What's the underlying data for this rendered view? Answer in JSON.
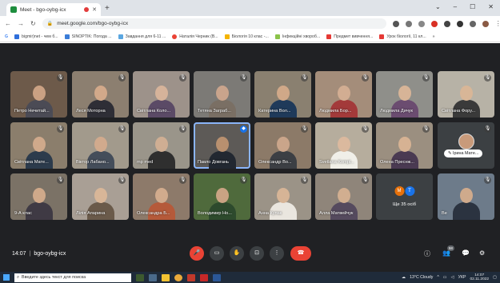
{
  "browser": {
    "tab_title": "Meet - bgo-oybg-icx",
    "new_tab": "+",
    "window_controls": [
      "⌄",
      "–",
      "☐",
      "✕"
    ],
    "url": "meet.google.com/bgo-oybg-icx"
  },
  "bookmarks": [
    {
      "label": "bigmir)net - чем б...",
      "color": "#2f6fdb"
    },
    {
      "label": "SINOPTIK: Погода ...",
      "color": "#3b7dd8"
    },
    {
      "label": "Завдання для 6-11 ...",
      "color": "#5aa6e0"
    },
    {
      "label": "Наталія Черник (В...",
      "color": "#ea4335"
    },
    {
      "label": "Біологія 10 клас -...",
      "color": "#f4b400"
    },
    {
      "label": "Інфекційні хвороб...",
      "color": "#8bc34a"
    },
    {
      "label": "Предмет вивчення...",
      "color": "#e53935"
    },
    {
      "label": "Урок біології, 11 кл...",
      "color": "#e53935"
    }
  ],
  "tiles": [
    {
      "name": "Петро Нечитай...",
      "bg": "#6d5a4a",
      "skin": "#caa183",
      "shirt": "#4b4b55",
      "mic": true
    },
    {
      "name": "Леся Моторна",
      "bg": "#8c7f70",
      "skin": "#d2a98a",
      "shirt": "#2e2e36",
      "mic": true
    },
    {
      "name": "Світлана Коло...",
      "bg": "#9d928a",
      "skin": "#d6b39a",
      "shirt": "#5b4a66",
      "mic": true
    },
    {
      "name": "Тетяна Заграб...",
      "bg": "#7c7a76",
      "skin": "#c9a48c",
      "shirt": "#7a6f64",
      "mic": true
    },
    {
      "name": "Катерина Вол...",
      "bg": "#8a8070",
      "skin": "#d0a888",
      "shirt": "#1f3a5a",
      "mic": true
    },
    {
      "name": "Людмила Бор...",
      "bg": "#a48d7a",
      "skin": "#d2ad92",
      "shirt": "#a33a3a",
      "mic": true
    },
    {
      "name": "Людмила Дичук",
      "bg": "#8f8f8a",
      "skin": "#d7b497",
      "shirt": "#6b4c70",
      "mic": true
    },
    {
      "name": "Світлана Фору...",
      "bg": "#b7b2a6",
      "skin": "#d8b697",
      "shirt": "#3a3a3a",
      "mic": true
    },
    {
      "name": "Світлана Мате...",
      "bg": "#8b7e6c",
      "skin": "#cfa98b",
      "shirt": "#2c3b4c",
      "mic": true
    },
    {
      "name": "Віктор Лабано...",
      "bg": "#a29a8c",
      "skin": "#d1aa8d",
      "shirt": "#444d5a",
      "mic": true
    },
    {
      "name": "mp med",
      "bg": "#9a958a",
      "skin": "#cfae93",
      "shirt": "#2f2f2f",
      "mic": true
    },
    {
      "name": "Павло Довгань",
      "bg": "#5d5a57",
      "skin": "#b8906f",
      "shirt": "#222831",
      "mic": false,
      "highlight": true
    },
    {
      "name": "Олександр Во...",
      "bg": "#8c7a68",
      "skin": "#caa58a",
      "shirt": "#3c3f44",
      "mic": true
    },
    {
      "name": "Svetlana Kompl...",
      "bg": "#b6ad9d",
      "skin": "#dbb99e",
      "shirt": "#f0efe8",
      "mic": true
    },
    {
      "name": "Олена Преснж...",
      "bg": "#9b8f80",
      "skin": "#d6b293",
      "shirt": "#4a3a52",
      "mic": true
    },
    {
      "name": "9-А клас",
      "bg": "#7b7266",
      "skin": "#cfa98a",
      "shirt": "#3f3a44",
      "mic": true
    },
    {
      "name": "Лілія Апарина",
      "bg": "#a99f95",
      "skin": "#d8b698",
      "shirt": "#6a5a4a",
      "mic": true
    },
    {
      "name": "Олександра Б...",
      "bg": "#8d7a6a",
      "skin": "#d1ab8d",
      "shirt": "#b55a3a",
      "mic": true
    },
    {
      "name": "Володимир Но...",
      "bg": "#4f6a3c",
      "skin": "#c9a383",
      "shirt": "#2d4a2d",
      "mic": true
    },
    {
      "name": "Анна Купак",
      "bg": "#9b9387",
      "skin": "#d6b496",
      "shirt": "#eae6df",
      "mic": true
    },
    {
      "name": "Алла Матвейчук",
      "bg": "#8f857a",
      "skin": "#d1ae90",
      "shirt": "#554a5e",
      "mic": true
    },
    {
      "name": "Ве",
      "bg": "#6d7b8a",
      "skin": "#cfaa8c",
      "shirt": "#2b3340",
      "mic": true
    }
  ],
  "avatar_tile": {
    "name": "Ірина Мате..."
  },
  "more_tile": {
    "initials": [
      "М",
      "Т"
    ],
    "label": "Ще 35 осіб"
  },
  "meeting": {
    "time": "14:07",
    "separator": "|",
    "code": "bgo-oybg-icx"
  },
  "controls": {
    "mic": "🎤",
    "camera": "▭",
    "hand": "✋",
    "present": "⊡",
    "more": "⋮",
    "end": "☎"
  },
  "right_controls": {
    "info": "ⓘ",
    "people": "👥",
    "people_count": "58",
    "chat": "💬",
    "activities": "⚙"
  },
  "taskbar": {
    "search_placeholder": "Введите здесь текст для поиска",
    "weather": "13°C Cloudy",
    "language": "УКР",
    "time": "14:07",
    "date": "02.11.2022"
  }
}
